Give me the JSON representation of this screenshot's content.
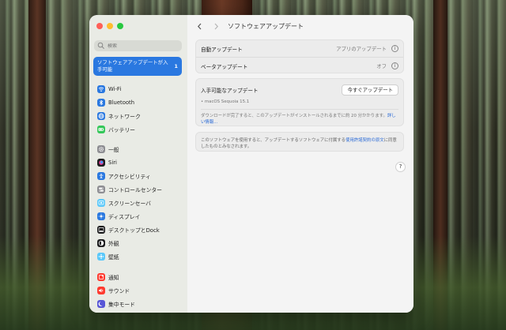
{
  "window": {
    "title": "ソフトウェアアップデート"
  },
  "sidebar": {
    "search_placeholder": "検索",
    "update_banner": {
      "label": "ソフトウェアアップデートが入手可能",
      "count": "1"
    },
    "items": [
      {
        "label": "Wi-Fi",
        "icon": "wifi-icon",
        "color": "#2a78e0"
      },
      {
        "label": "Bluetooth",
        "icon": "bluetooth-icon",
        "color": "#2a78e0"
      },
      {
        "label": "ネットワーク",
        "icon": "globe-icon",
        "color": "#2a78e0"
      },
      {
        "label": "バッテリー",
        "icon": "battery-icon",
        "color": "#34c759"
      },
      {
        "label": "一般",
        "icon": "gear-icon",
        "color": "#8e8e93"
      },
      {
        "label": "Siri",
        "icon": "siri-icon",
        "color": "#1c1c1e"
      },
      {
        "label": "アクセシビリティ",
        "icon": "accessibility-icon",
        "color": "#2a78e0"
      },
      {
        "label": "コントロールセンター",
        "icon": "control-center-icon",
        "color": "#8e8e93"
      },
      {
        "label": "スクリーンセーバ",
        "icon": "screensaver-icon",
        "color": "#5ac8fa"
      },
      {
        "label": "ディスプレイ",
        "icon": "display-icon",
        "color": "#2a78e0"
      },
      {
        "label": "デスクトップとDock",
        "icon": "dock-icon",
        "color": "#1c1c1e"
      },
      {
        "label": "外観",
        "icon": "appearance-icon",
        "color": "#1c1c1e"
      },
      {
        "label": "壁紙",
        "icon": "wallpaper-icon",
        "color": "#5ac8fa"
      },
      {
        "label": "通知",
        "icon": "bell-icon",
        "color": "#ff3b30"
      },
      {
        "label": "サウンド",
        "icon": "speaker-icon",
        "color": "#ff3b30"
      },
      {
        "label": "集中モード",
        "icon": "moon-icon",
        "color": "#5856d6"
      }
    ]
  },
  "settings": {
    "auto_update": {
      "label": "自動アップデート",
      "value": "アプリのアップデート"
    },
    "beta_update": {
      "label": "ベータアップデート",
      "value": "オフ"
    }
  },
  "available": {
    "title": "入手可能なアップデート",
    "button": "今すぐアップデート",
    "version": "• macOS Sequoia 15.1",
    "note": "ダウンロードが完了すると、このアップデートがインストールされるまでに約 20 分かかります。",
    "more_link": "詳しい情報..."
  },
  "license": {
    "text": "このソフトウェアを使用すると、アップデートするソフトウェアに付属する",
    "link": "使用許諾契約の原文",
    "suffix": "に同意したものとみなされます。"
  },
  "help": "?"
}
